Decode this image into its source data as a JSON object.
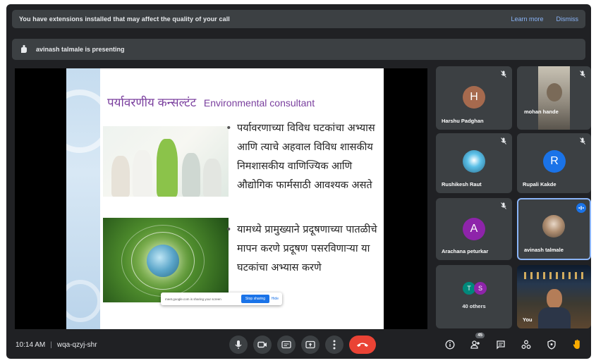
{
  "banners": {
    "extensions_message": "You have extensions installed that may affect the quality of your call",
    "learn_more": "Learn more",
    "dismiss": "Dismiss",
    "presenting_message": "avinash talmale is presenting"
  },
  "slide": {
    "title_marathi": "पर्यावरणीय कन्सल्टंट",
    "title_english": "Environmental consultant",
    "bullet_1": "पर्यावरणाच्या विविध घटकांचा अभ्यास आणि त्याचे अहवाल विविध शासकीय निमशासकीय वाणिज्यिक आणि औद्योगिक फार्मसाठी आवश्यक असते",
    "bullet_2": "यामध्ये प्रामुख्याने प्रदूषणाच्या पातळीचे मापन करणे प्रदूषण पसरविणाऱ्या या घटकांचा अभ्यास करणे",
    "popup_text": "meet.google.com is sharing your screen",
    "popup_stop": "Stop sharing",
    "popup_hide": "Hide"
  },
  "participants": [
    {
      "name": "Harshu Padghan",
      "initial": "H",
      "color": "#a66a4e"
    },
    {
      "name": "mohan hande",
      "initial": "",
      "color": ""
    },
    {
      "name": "Rushikesh Raut",
      "initial": "",
      "color": ""
    },
    {
      "name": "Rupali Kakde",
      "initial": "R",
      "color": "#1a73e8"
    },
    {
      "name": "Arachana peturkar",
      "initial": "A",
      "color": "#8e24aa"
    },
    {
      "name": "avinash talmale",
      "initial": "",
      "color": ""
    }
  ],
  "others_tile": {
    "initial_1": "T",
    "initial_2": "S",
    "label": "40 others"
  },
  "self_tile": {
    "label": "You"
  },
  "meeting": {
    "time": "10:14 AM",
    "code": "wqa-qzyj-shr"
  },
  "controls": {
    "center": [
      "mic-icon",
      "camera-icon",
      "captions-icon",
      "present-icon",
      "more-options-icon",
      "end-call-icon"
    ],
    "right": [
      "info-icon",
      "people-icon",
      "chat-icon",
      "activities-icon",
      "host-controls-icon",
      "hand-raise-icon"
    ],
    "people_badge": "45"
  },
  "colors": {
    "background": "#202124",
    "surface": "#3c4043",
    "accent_blue": "#8ab4f8",
    "end_call_red": "#ea4335",
    "slide_title_purple": "#7a3f9e"
  }
}
